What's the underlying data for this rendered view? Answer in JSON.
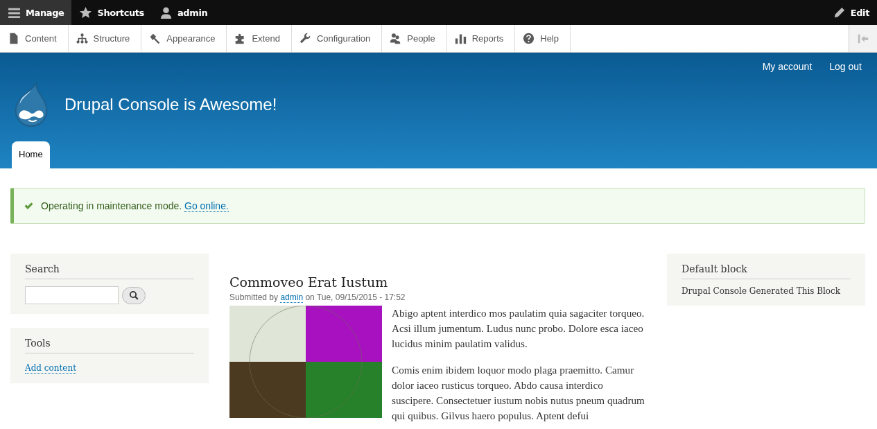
{
  "toolbar": {
    "items": [
      {
        "label": "Manage",
        "selected": true
      },
      {
        "label": "Shortcuts",
        "selected": false
      },
      {
        "label": "admin",
        "selected": false
      }
    ],
    "edit": {
      "label": "Edit"
    }
  },
  "tray": {
    "items": [
      {
        "label": "Content"
      },
      {
        "label": "Structure"
      },
      {
        "label": "Appearance"
      },
      {
        "label": "Extend"
      },
      {
        "label": "Configuration"
      },
      {
        "label": "People"
      },
      {
        "label": "Reports"
      },
      {
        "label": "Help"
      }
    ]
  },
  "header": {
    "secondary_menu": [
      "My account",
      "Log out"
    ],
    "site_name": "Drupal Console is Awesome!",
    "tabs": [
      {
        "label": "Home",
        "selected": true
      }
    ]
  },
  "message": {
    "text": "Operating in maintenance mode.",
    "link": "Go online."
  },
  "sidebar_first": [
    {
      "title": "Search",
      "kind": "search"
    },
    {
      "title": "Tools",
      "kind": "links",
      "links": [
        "Add content"
      ]
    }
  ],
  "article": {
    "title": "Commoveo Erat Iustum",
    "submitted": {
      "prefix": "Submitted by",
      "author": "admin",
      "suffix": "on Tue, 09/15/2015 - 17:52"
    },
    "paragraphs": [
      "Abigo aptent interdico mos paulatim quia sagaciter torqueo. Acsi illum jumentum. Ludus nunc probo. Dolore esca iaceo lucidus minim paulatim validus.",
      "Comis enim ibidem loquor modo plaga praemitto. Camur dolor iaceo rusticus torqueo. Abdo causa interdico suscipere. Consectetuer iustum nobis nutus pneum quadrum qui quibus. Gilvus haero populus. Aptent defui"
    ]
  },
  "sidebar_second": [
    {
      "title": "Default block",
      "kind": "text",
      "text": "Drupal Console Generated This Block"
    }
  ]
}
